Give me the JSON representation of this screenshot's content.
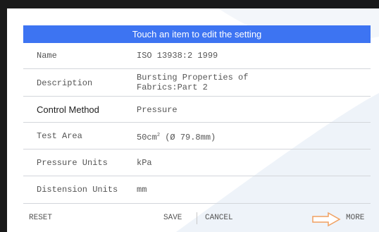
{
  "header": {
    "title": "Touch an item to edit the setting"
  },
  "rows": [
    {
      "label": "Name",
      "value": "ISO 13938:2 1999"
    },
    {
      "label": "Description",
      "value_line1": "Bursting Properties of",
      "value_line2": "Fabrics:Part 2"
    },
    {
      "label": "Control Method",
      "value": "Pressure"
    },
    {
      "label": "Test Area",
      "value_prefix": "50cm",
      "value_sup": "2",
      "value_suffix": " (Ø 79.8mm)"
    },
    {
      "label": "Pressure Units",
      "value": "kPa"
    },
    {
      "label": "Distension Units",
      "value": "mm"
    }
  ],
  "footer": {
    "reset": "RESET",
    "save": "SAVE",
    "cancel": "CANCEL",
    "more": "MORE",
    "more_icon": "right-arrow-outline-icon"
  },
  "colors": {
    "header_bg": "#3d74f2",
    "arrow": "#f0a060"
  }
}
